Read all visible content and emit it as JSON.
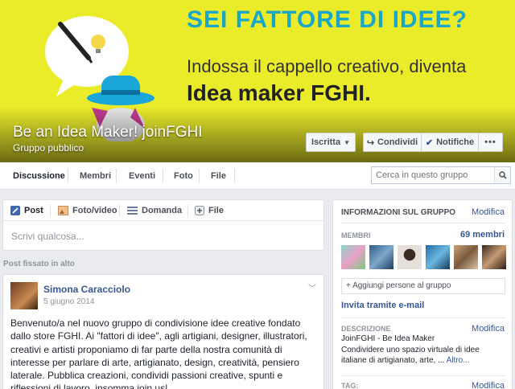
{
  "cover": {
    "headline": "SEI FATTORE DI IDEE?",
    "subline": "Indossa il cappello creativo, diventa",
    "subline2": "Idea maker FGHI.",
    "group_name": "Be an Idea Maker! joinFGHI",
    "group_type": "Gruppo pubblico",
    "buttons": {
      "iscritta": "Iscritta",
      "condividi": "Condividi",
      "notifiche": "Notifiche",
      "more": "•••"
    }
  },
  "tabs": [
    "Discussione",
    "Membri",
    "Eventi",
    "Foto",
    "File"
  ],
  "search": {
    "placeholder": "Cerca in questo gruppo"
  },
  "composer": {
    "tabs": [
      "Post",
      "Foto/video",
      "Domanda",
      "File"
    ],
    "placeholder": "Scrivi qualcosa..."
  },
  "pinned_label": "Post fissato in alto",
  "post": {
    "author": "Simona Caracciolo",
    "date": "5 giugno 2014",
    "text": "Benvenuto/a nel nuovo gruppo di condivisione idee creative fondato dallo store FGHI. Ai \"fattori di idee\", agli artigiani, designer, illustratori, creativi e artisti proponiamo di far parte della nostra comunità di interesse per parlare di arte, artigianato, design, creatività, pensiero laterale. Pubblica creazioni, condividi passioni creative, spunti e riflessioni di lavoro. insomma join us!"
  },
  "info": {
    "title": "INFORMAZIONI SUL GRUPPO",
    "edit": "Modifica",
    "members_label": "MEMBRI",
    "members_count": "69 membri",
    "add_members": "+ Aggiungi persone al gruppo",
    "invite": "Invita tramite e-mail",
    "description_label": "DESCRIZIONE",
    "description_line1": "JoinFGHI - Be Idea Maker",
    "description_line2": "Condividere uno spazio virtuale di idee italiane di artigianato, arte, ...",
    "description_more": "Altro...",
    "tags_label": "TAG:",
    "tags_edit": "Modifica"
  },
  "colors": {
    "cover_bg": "#eaec2a",
    "headline": "#1aa6c9",
    "link": "#365899"
  }
}
